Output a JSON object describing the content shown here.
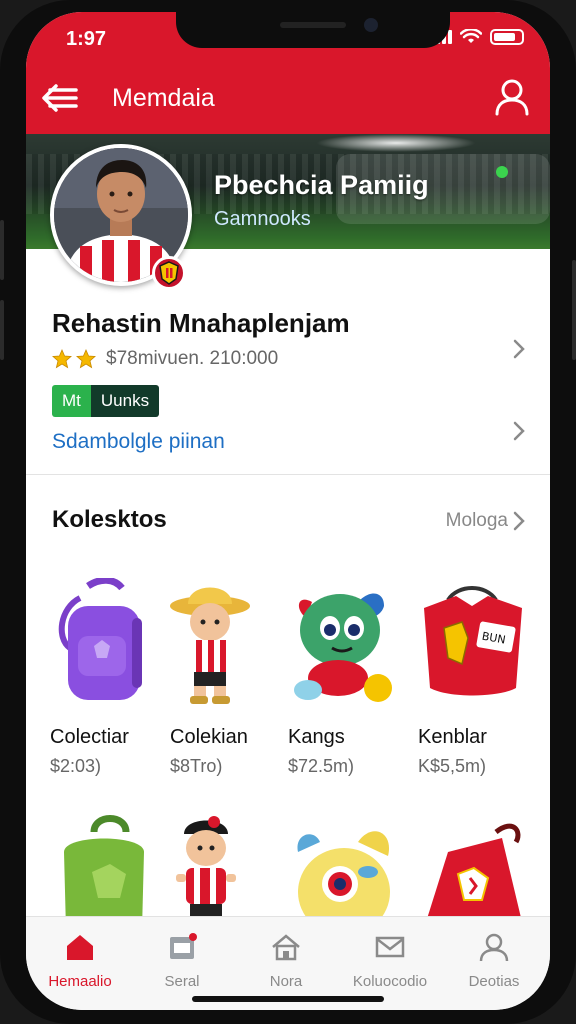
{
  "status": {
    "time": "1:97"
  },
  "appbar": {
    "title": "Memdaia"
  },
  "hero": {
    "name": "Pbechcia Pamiig",
    "subtitle": "Gamnooks"
  },
  "profile": {
    "name": "Rehastin Mnahaplenjam",
    "rating_text": "$78mivuen. 210:000",
    "badge_left": "Mt",
    "badge_right": "Uunks",
    "plan_link": "Sdambolgle piinan"
  },
  "collections": {
    "title": "Kolesktos",
    "more": "Mologa",
    "items": [
      {
        "title": "Colectiar",
        "price": "$2:03)",
        "icon": "purple-backpack"
      },
      {
        "title": "Colekian",
        "price": "$8Tro)",
        "icon": "cowboy-figure"
      },
      {
        "title": "Kangs",
        "price": "$72.5m)",
        "icon": "plush-creature"
      },
      {
        "title": "Kenblar",
        "price": "K$5,5m)",
        "icon": "red-jersey-bag"
      },
      {
        "icon": "green-backpack"
      },
      {
        "icon": "player-figure"
      },
      {
        "icon": "yellow-plush"
      },
      {
        "icon": "red-drawstring-bag"
      }
    ]
  },
  "tabs": [
    {
      "label": "Hemaalio",
      "icon": "home-icon"
    },
    {
      "label": "Seral",
      "icon": "store-icon"
    },
    {
      "label": "Nora",
      "icon": "house-icon"
    },
    {
      "label": "Koluocodio",
      "icon": "mail-icon"
    },
    {
      "label": "Deotias",
      "icon": "profile-icon"
    }
  ],
  "colors": {
    "accent": "#d9172b",
    "link": "#1e6fc4",
    "badge_green": "#2bb24c",
    "badge_dark": "#123a2a"
  }
}
